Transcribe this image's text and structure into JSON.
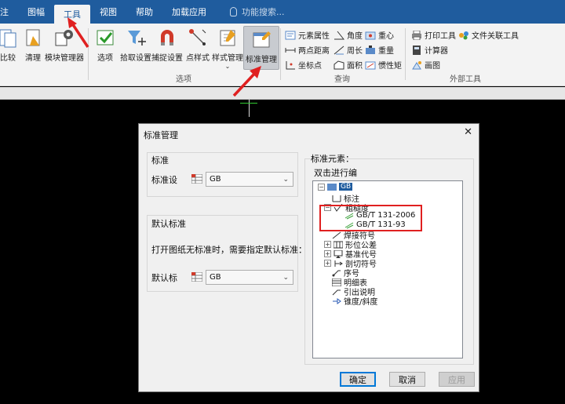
{
  "menubar": {
    "items": [
      {
        "label": "注",
        "active": false
      },
      {
        "label": "图幅",
        "active": false
      },
      {
        "label": "工具",
        "active": true
      },
      {
        "label": "视图",
        "active": false
      },
      {
        "label": "帮助",
        "active": false
      },
      {
        "label": "加载应用",
        "active": false
      }
    ],
    "search_placeholder": "功能搜索..."
  },
  "ribbon": {
    "buttons": [
      {
        "label": "比较"
      },
      {
        "label": "清理"
      },
      {
        "label": "模块管理器"
      },
      {
        "label": "选项"
      },
      {
        "label": "拾取设置"
      },
      {
        "label": "捕捉设置"
      },
      {
        "label": "点样式"
      },
      {
        "label": "样式管理"
      },
      {
        "label": "标准管理"
      }
    ],
    "group_options": "选项",
    "query_items": [
      {
        "label": "元素属性"
      },
      {
        "label": "角度"
      },
      {
        "label": "重心"
      },
      {
        "label": "两点距离"
      },
      {
        "label": "周长"
      },
      {
        "label": "重量"
      },
      {
        "label": "坐标点"
      },
      {
        "label": "面积"
      },
      {
        "label": "惯性矩"
      }
    ],
    "group_query": "查询",
    "external_items": [
      {
        "label": "打印工具"
      },
      {
        "label": "文件关联工具"
      },
      {
        "label": "计算器"
      },
      {
        "label": "画图"
      }
    ],
    "group_external": "外部工具"
  },
  "dialog": {
    "title": "标准管理",
    "close": "✕",
    "left": {
      "standard_title": "标准",
      "standard_label": "标准设",
      "standard_value": "GB",
      "default_title": "默认标准",
      "default_hint": "打开图纸无标准时，需要指定默认标准：",
      "default_label": "默认标",
      "default_value": "GB"
    },
    "right": {
      "title": "标准元素：",
      "hint": "双击进行编",
      "tree": {
        "root": "GB",
        "items": [
          {
            "label": "标注"
          },
          {
            "label": "粗糙度"
          },
          {
            "label": "GB/T 131-2006"
          },
          {
            "label": "GB/T 131-93"
          },
          {
            "label": "焊接符号"
          },
          {
            "label": "形位公差"
          },
          {
            "label": "基准代号"
          },
          {
            "label": "剖切符号"
          },
          {
            "label": "序号"
          },
          {
            "label": "明细表"
          },
          {
            "label": "引出说明"
          },
          {
            "label": "锥度/斜度"
          }
        ]
      }
    },
    "buttons": {
      "ok": "确定",
      "cancel": "取消",
      "apply": "应用"
    }
  }
}
